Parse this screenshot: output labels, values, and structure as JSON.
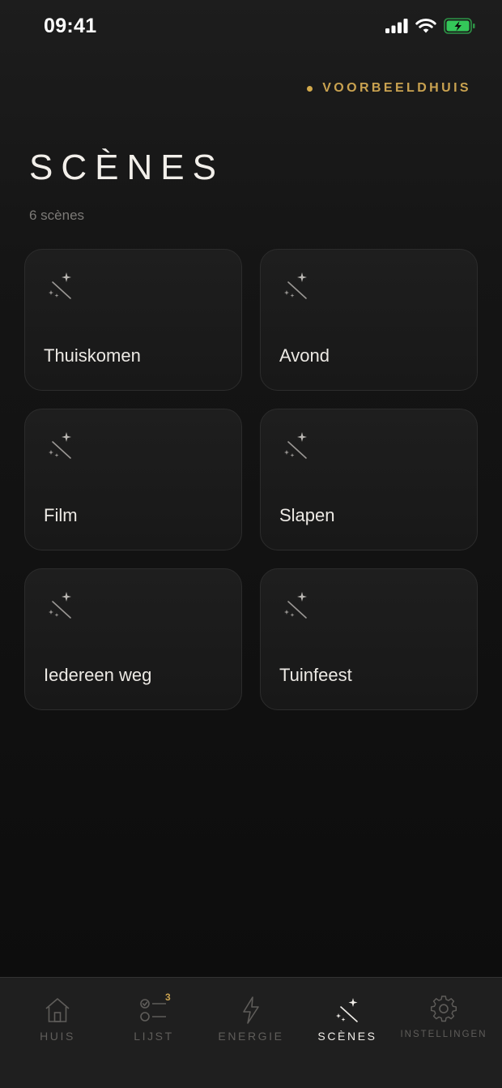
{
  "status_bar": {
    "time": "09:41"
  },
  "home": {
    "name": "VOORBEELDHUIS",
    "dot_color": "#d2a94b"
  },
  "page": {
    "title": "SCÈNES",
    "subtitle": "6 scènes"
  },
  "scenes": [
    {
      "label": "Thuiskomen",
      "icon": "magic-wand-icon"
    },
    {
      "label": "Avond",
      "icon": "magic-wand-icon"
    },
    {
      "label": "Film",
      "icon": "magic-wand-icon"
    },
    {
      "label": "Slapen",
      "icon": "magic-wand-icon"
    },
    {
      "label": "Iedereen weg",
      "icon": "magic-wand-icon"
    },
    {
      "label": "Tuinfeest",
      "icon": "magic-wand-icon"
    }
  ],
  "tab_bar": {
    "tabs": [
      {
        "label": "HUIS",
        "icon": "house-icon",
        "active": false
      },
      {
        "label": "LIJST",
        "icon": "checklist-icon",
        "badge": "3",
        "active": false
      },
      {
        "label": "ENERGIE",
        "icon": "lightning-icon",
        "active": false
      },
      {
        "label": "SCÈNES",
        "icon": "magic-wand-icon",
        "active": true
      },
      {
        "label": "INSTELLINGEN",
        "icon": "gear-icon",
        "active": false
      }
    ]
  },
  "colors": {
    "accent": "#c9a250",
    "battery": "#34c759",
    "background": "#111111"
  }
}
